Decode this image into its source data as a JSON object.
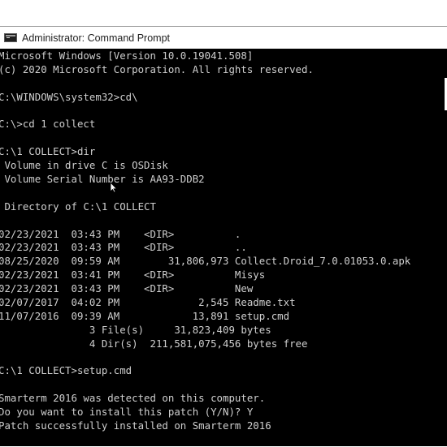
{
  "window": {
    "title": "Administrator: Command Prompt",
    "icon": "cmd-app-icon"
  },
  "console": {
    "lines": [
      "Microsoft Windows [Version 10.0.19041.508]",
      "(c) 2020 Microsoft Corporation. All rights reserved.",
      "",
      "C:\\WINDOWS\\system32>cd\\",
      "",
      "C:\\>cd 1 collect",
      "",
      "C:\\1 COLLECT>dir",
      " Volume in drive C is OSDisk",
      " Volume Serial Number is AA93-DDB2",
      "",
      " Directory of C:\\1 COLLECT",
      "",
      "02/23/2021  03:43 PM    <DIR>          .",
      "02/23/2021  03:43 PM    <DIR>          ..",
      "08/25/2020  09:59 AM        31,806,973 Collect.Droid_7.0.01053.0.apk",
      "02/23/2021  03:41 PM    <DIR>          Misys",
      "02/23/2021  03:43 PM    <DIR>          New",
      "02/07/2017  04:02 PM             2,545 Readme.txt",
      "11/07/2016  09:39 AM            13,891 setup.cmd",
      "               3 File(s)     31,823,409 bytes",
      "               4 Dir(s)  211,581,075,456 bytes free",
      "",
      "C:\\1 COLLECT>setup.cmd",
      "",
      "Smarterm 2016 was detected on this computer.",
      "Do you want to install this patch (Y/N)? Y",
      "Patch successfully installed on Smarterm 2016",
      "",
      "C:\\1 COLLECT>"
    ]
  },
  "colors": {
    "console_bg": "#000000",
    "console_text": "#cfcfcf",
    "titlebar_bg": "#ffffff"
  }
}
